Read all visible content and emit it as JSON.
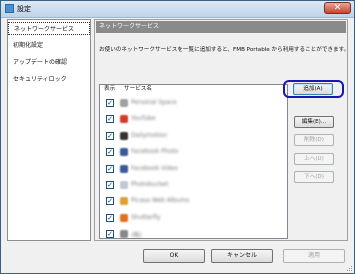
{
  "window": {
    "title": "設定",
    "close_glyph": "✕"
  },
  "sidebar": {
    "items": [
      {
        "label": "ネットワークサービス",
        "selected": true
      },
      {
        "label": "初期化設定",
        "selected": false
      },
      {
        "label": "アップデートの確認",
        "selected": false
      },
      {
        "label": "セキュリティロック",
        "selected": false
      }
    ]
  },
  "panel": {
    "header": "ネットワークサービス",
    "description": "お使いのネットワークサービスを一覧に追加すると、FMB Portable から利用することができます。"
  },
  "list": {
    "columns": [
      "表示",
      "サービス名"
    ],
    "check_glyph": "✓",
    "rows": [
      {
        "checked": true,
        "name": "Personal Space",
        "icon_color": "#a0a0a0"
      },
      {
        "checked": true,
        "name": "YouTube",
        "icon_color": "#d23a2a"
      },
      {
        "checked": true,
        "name": "Dailymotion",
        "icon_color": "#333333"
      },
      {
        "checked": true,
        "name": "Facebook Photo",
        "icon_color": "#3b5998"
      },
      {
        "checked": true,
        "name": "Facebook Video",
        "icon_color": "#3b5998"
      },
      {
        "checked": true,
        "name": "Photobucket",
        "icon_color": "#c0c8d8"
      },
      {
        "checked": true,
        "name": "Picasa Web Albums",
        "icon_color": "#e0a030"
      },
      {
        "checked": true,
        "name": "Shutterfly",
        "icon_color": "#e07020"
      },
      {
        "checked": true,
        "name": "(株)",
        "icon_color": "#888888"
      }
    ]
  },
  "side_buttons": {
    "add": "追加(A)",
    "edit": "編集(E)...",
    "delete": "削除(D)",
    "up": "上へ(U)",
    "down": "下へ(D)"
  },
  "footer": {
    "ok": "OK",
    "cancel": "キャンセル",
    "apply": "適用"
  },
  "colors": {
    "highlight": "#1818b0",
    "header_bg": "#8a8a8a",
    "titlebar": "#bfd3e8"
  }
}
